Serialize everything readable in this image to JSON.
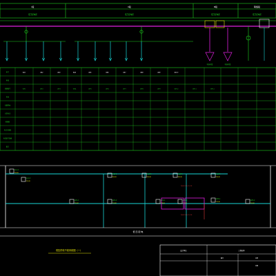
{
  "drawing": {
    "header_sections": [
      {
        "label": "Ⅰ段",
        "color": "#ffffff"
      },
      {
        "label": "Ⅱ段",
        "color": "#ffffff"
      },
      {
        "label": "Ⅲ段",
        "color": "#ffffff"
      },
      {
        "label": "联络段",
        "color": "#ffffff"
      }
    ],
    "header_subtitles": [
      "低压配电柜",
      "低压配电柜",
      "低压配电柜",
      "低压配电柜"
    ],
    "equipment_labels": [
      "电容补偿",
      "电容补偿"
    ],
    "row_labels": [
      "柜号",
      "柜型",
      "回路编号",
      "用途",
      "设备容量",
      "计算电流",
      "断路器",
      "电流互感器",
      "电缆型号规格",
      "备注"
    ],
    "panel_codes": [
      "AA1",
      "AA2",
      "AA3",
      "AA4",
      "AA5",
      "AA6",
      "AA7",
      "AA8",
      "AA9",
      "AA10"
    ],
    "circuit_codes": [
      "WP1",
      "WP2",
      "WP3",
      "WP4",
      "WP5",
      "WP6",
      "WP7",
      "WP8",
      "WP9",
      "WP10",
      "WP11",
      "WP12"
    ],
    "busbar_title": "低压母线",
    "riser_labels": [
      {
        "id": "AL1-1",
        "cap": "30kW"
      },
      {
        "id": "AL1-2",
        "cap": "25kW"
      },
      {
        "id": "AL2-1",
        "cap": "40kW"
      },
      {
        "id": "AL2-2",
        "cap": "35kW"
      },
      {
        "id": "AL3-1",
        "cap": "45kW"
      },
      {
        "id": "AL3-2",
        "cap": "30kW"
      },
      {
        "id": "AP1-1",
        "cap": "15kW"
      },
      {
        "id": "AP1-2",
        "cap": "20kW"
      },
      {
        "id": "AP2-1",
        "cap": "18kW"
      },
      {
        "id": "AP2-2",
        "cap": "22kW"
      },
      {
        "id": "AP3-1",
        "cap": "12kW"
      },
      {
        "id": "AP3-2",
        "cap": "16kW"
      }
    ],
    "cable_notes": [
      "YJV-4×35+1×16",
      "YJV-4×25+1×16"
    ],
    "footer_label": "低  压  配  电",
    "drawing_title": "低压供电干线系统图（一）",
    "title_block": {
      "company": "设计单位",
      "project": "工程名称",
      "drawing_no": "图号",
      "scale": "比例",
      "date": "日期"
    }
  }
}
